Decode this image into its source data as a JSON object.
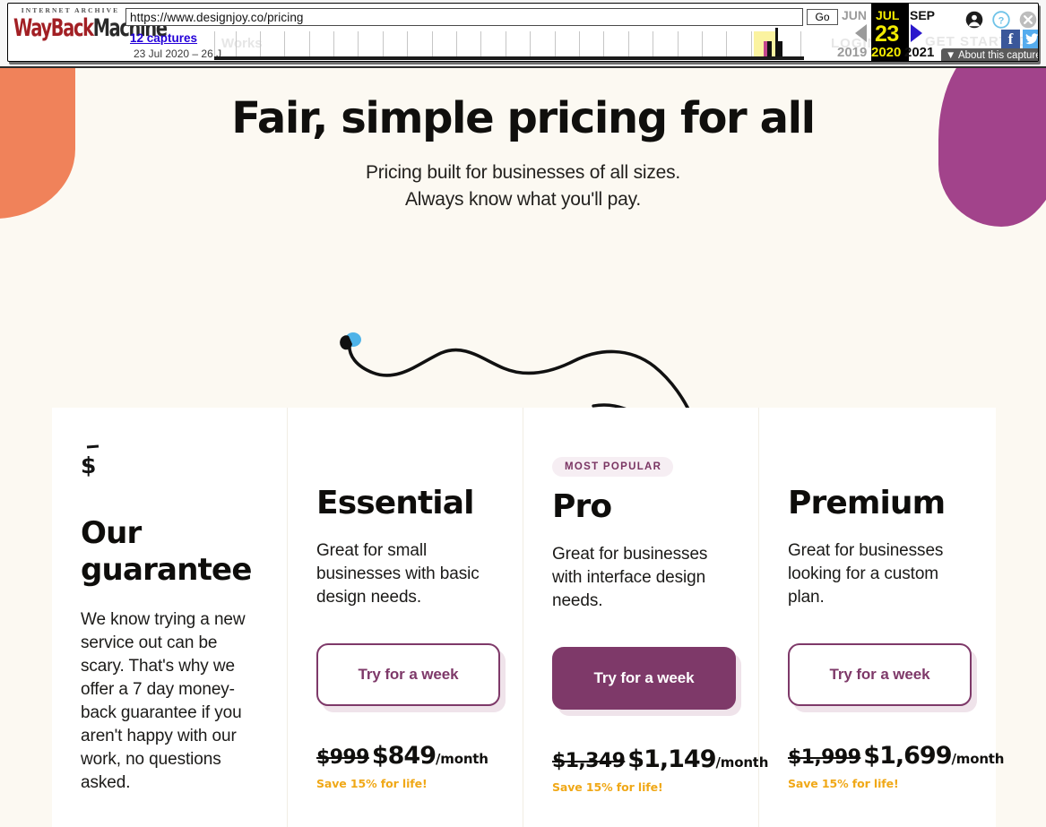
{
  "wayback": {
    "logo_top": "INTERNET ARCHIVE",
    "logo_way": "WayBack",
    "logo_machine": "Machine",
    "url": "https://www.designjoy.co/pricing",
    "go_label": "Go",
    "captures_link": "12 captures",
    "captures_range": "23 Jul 2020 – 26 J",
    "prev_month": "JUN",
    "prev_year": "2019",
    "sel_month": "JUL",
    "sel_day": "23",
    "sel_year": "2020",
    "next_month": "SEP",
    "next_year": "2021",
    "about_label": "About this capture",
    "about_caret": "▼",
    "facebook_glyph": "f",
    "twitter_glyph": "🐦",
    "icons": {
      "account": "account-icon",
      "help": "help-icon",
      "close": "close-icon",
      "prev_arrow": "prev-capture-arrow-icon",
      "next_arrow": "next-capture-arrow-icon"
    },
    "ghost_text_left": "Works",
    "ghost_text_right": "GET STARTED",
    "ghost_text_login": "LOGIN"
  },
  "hero": {
    "title": "Fair, simple pricing for all",
    "subtitle_line1": "Pricing built for businesses of all sizes.",
    "subtitle_line2": "Always know what you'll pay."
  },
  "decor": {
    "squiggle_start_dot_color": "#4EB3E8",
    "squiggle_end_dot_color": "#F5873A",
    "blob_left_color": "#F0825A",
    "blob_right_color": "#A2438B",
    "stroke_color": "#111111"
  },
  "guarantee": {
    "icon": "dollar-sign-icon",
    "title": "Our guarantee",
    "body": "We know trying a new service out can be scary. That's why we offer a 7 day money-back guarantee if you aren't happy with our work, no questions asked."
  },
  "plans": [
    {
      "badge": "",
      "name": "Essential",
      "description": "Great for small businesses with basic design needs.",
      "cta": "Try for a week",
      "cta_style": "outline",
      "price_old": "$999",
      "price_new": "$849",
      "price_period": "/month",
      "save_note": "Save 15% for life!"
    },
    {
      "badge": "MOST POPULAR",
      "name": "Pro",
      "description": "Great for businesses with interface design needs.",
      "cta": "Try for a week",
      "cta_style": "solid",
      "price_old": "$1,349",
      "price_new": "$1,149",
      "price_period": "/month",
      "save_note": "Save 15% for life!"
    },
    {
      "badge": "",
      "name": "Premium",
      "description": "Great for businesses looking for a custom plan.",
      "cta": "Try for a week",
      "cta_style": "outline",
      "price_old": "$1,999",
      "price_new": "$1,699",
      "price_period": "/month",
      "save_note": "Save 15% for life!"
    }
  ],
  "colors": {
    "page_bg": "#FCF9F2",
    "card_bg": "#FFFFFF",
    "accent_purple": "#7E3969",
    "save_amber": "#F0A817",
    "badge_bg": "#F6EEF3"
  }
}
